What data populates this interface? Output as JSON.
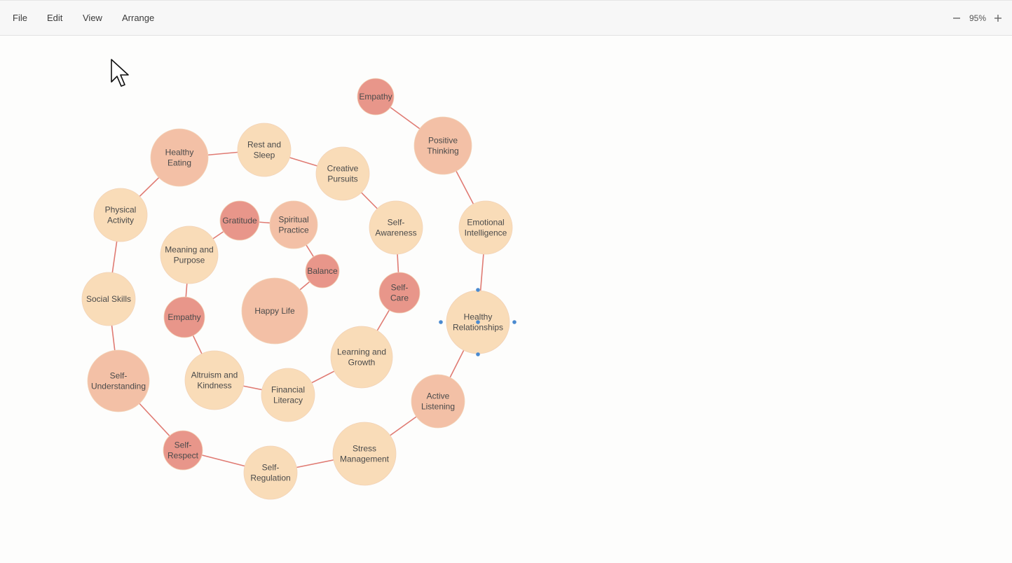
{
  "menu": {
    "file": "File",
    "edit": "Edit",
    "view": "View",
    "arrange": "Arrange"
  },
  "zoom": {
    "level": "95%",
    "out_icon": "minus-icon",
    "in_icon": "plus-icon"
  },
  "colors": {
    "edge": "#e07b73",
    "node_light": "#f9dcb8",
    "node_mid": "#f3c0a6",
    "node_dark": "#e8968a",
    "selection": "#4a8ad0"
  },
  "diagram": {
    "selected": "healthy-relationships",
    "nodes": [
      {
        "id": "happy-life",
        "lines": [
          "Happy Life"
        ],
        "tone": "mid"
      },
      {
        "id": "balance",
        "lines": [
          "Balance"
        ],
        "tone": "dark"
      },
      {
        "id": "spiritual-practice",
        "lines": [
          "Spiritual",
          "Practice"
        ],
        "tone": "mid"
      },
      {
        "id": "gratitude",
        "lines": [
          "Gratitude"
        ],
        "tone": "dark"
      },
      {
        "id": "meaning-and-purpose",
        "lines": [
          "Meaning and",
          "Purpose"
        ],
        "tone": "light"
      },
      {
        "id": "empathy-inner",
        "lines": [
          "Empathy"
        ],
        "tone": "dark"
      },
      {
        "id": "altruism-and-kindness",
        "lines": [
          "Altruism and",
          "Kindness"
        ],
        "tone": "light"
      },
      {
        "id": "financial-literacy",
        "lines": [
          "Financial",
          "Literacy"
        ],
        "tone": "light"
      },
      {
        "id": "learning-and-growth",
        "lines": [
          "Learning and",
          "Growth"
        ],
        "tone": "light"
      },
      {
        "id": "self-care",
        "lines": [
          "Self-",
          "Care"
        ],
        "tone": "dark"
      },
      {
        "id": "self-awareness",
        "lines": [
          "Self-",
          "Awareness"
        ],
        "tone": "light"
      },
      {
        "id": "creative-pursuits",
        "lines": [
          "Creative",
          "Pursuits"
        ],
        "tone": "light"
      },
      {
        "id": "rest-and-sleep",
        "lines": [
          "Rest and",
          "Sleep"
        ],
        "tone": "light"
      },
      {
        "id": "healthy-eating",
        "lines": [
          "Healthy",
          "Eating"
        ],
        "tone": "mid"
      },
      {
        "id": "physical-activity",
        "lines": [
          "Physical",
          "Activity"
        ],
        "tone": "light"
      },
      {
        "id": "social-skills",
        "lines": [
          "Social Skills"
        ],
        "tone": "light"
      },
      {
        "id": "self-understanding",
        "lines": [
          "Self-",
          "Understanding"
        ],
        "tone": "mid"
      },
      {
        "id": "self-respect",
        "lines": [
          "Self-",
          "Respect"
        ],
        "tone": "dark"
      },
      {
        "id": "self-regulation",
        "lines": [
          "Self-",
          "Regulation"
        ],
        "tone": "light"
      },
      {
        "id": "stress-management",
        "lines": [
          "Stress",
          "Management"
        ],
        "tone": "light"
      },
      {
        "id": "active-listening",
        "lines": [
          "Active",
          "Listening"
        ],
        "tone": "mid"
      },
      {
        "id": "healthy-relationships",
        "lines": [
          "Healthy",
          "Relationships"
        ],
        "tone": "light"
      },
      {
        "id": "emotional-intelligence",
        "lines": [
          "Emotional",
          "Intelligence"
        ],
        "tone": "light"
      },
      {
        "id": "positive-thinking",
        "lines": [
          "Positive",
          "Thinking"
        ],
        "tone": "mid"
      },
      {
        "id": "empathy-outer",
        "lines": [
          "Empathy"
        ],
        "tone": "dark"
      }
    ],
    "edges": [
      [
        "happy-life",
        "balance"
      ],
      [
        "balance",
        "spiritual-practice"
      ],
      [
        "spiritual-practice",
        "gratitude"
      ],
      [
        "gratitude",
        "meaning-and-purpose"
      ],
      [
        "meaning-and-purpose",
        "empathy-inner"
      ],
      [
        "empathy-inner",
        "altruism-and-kindness"
      ],
      [
        "altruism-and-kindness",
        "financial-literacy"
      ],
      [
        "financial-literacy",
        "learning-and-growth"
      ],
      [
        "learning-and-growth",
        "self-care"
      ],
      [
        "self-care",
        "self-awareness"
      ],
      [
        "self-awareness",
        "creative-pursuits"
      ],
      [
        "creative-pursuits",
        "rest-and-sleep"
      ],
      [
        "rest-and-sleep",
        "healthy-eating"
      ],
      [
        "healthy-eating",
        "physical-activity"
      ],
      [
        "physical-activity",
        "social-skills"
      ],
      [
        "social-skills",
        "self-understanding"
      ],
      [
        "self-understanding",
        "self-respect"
      ],
      [
        "self-respect",
        "self-regulation"
      ],
      [
        "self-regulation",
        "stress-management"
      ],
      [
        "stress-management",
        "active-listening"
      ],
      [
        "active-listening",
        "healthy-relationships"
      ],
      [
        "healthy-relationships",
        "emotional-intelligence"
      ],
      [
        "emotional-intelligence",
        "positive-thinking"
      ],
      [
        "positive-thinking",
        "empathy-outer"
      ]
    ]
  },
  "cursor": {
    "icon": "mouse-pointer-icon"
  }
}
